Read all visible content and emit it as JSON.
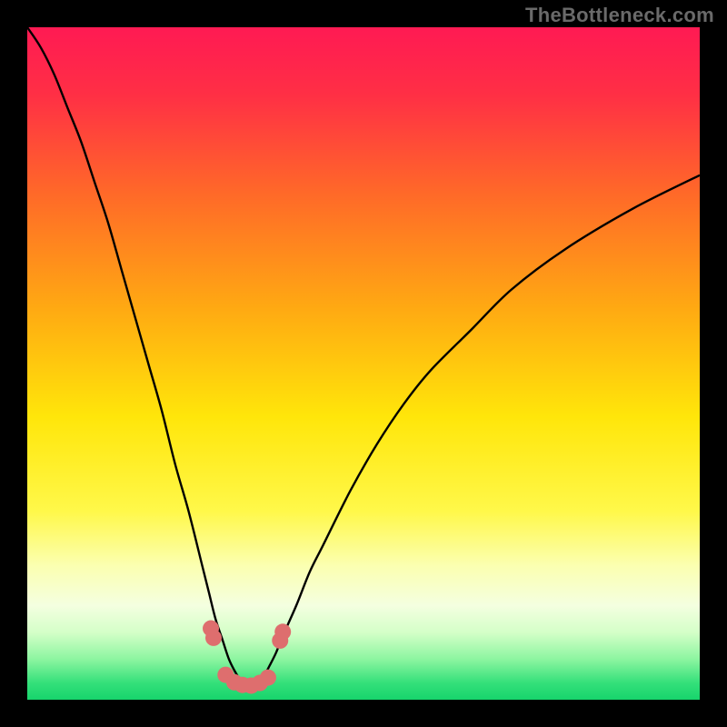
{
  "watermark": "TheBottleneck.com",
  "gradient_stops": [
    {
      "offset": 0.0,
      "color": "#ff1a53"
    },
    {
      "offset": 0.1,
      "color": "#ff2f45"
    },
    {
      "offset": 0.25,
      "color": "#ff6a28"
    },
    {
      "offset": 0.42,
      "color": "#ffaa12"
    },
    {
      "offset": 0.58,
      "color": "#ffe60a"
    },
    {
      "offset": 0.72,
      "color": "#fff84a"
    },
    {
      "offset": 0.8,
      "color": "#fbffb0"
    },
    {
      "offset": 0.86,
      "color": "#f4ffe0"
    },
    {
      "offset": 0.9,
      "color": "#d4ffc8"
    },
    {
      "offset": 0.94,
      "color": "#8cf5a0"
    },
    {
      "offset": 0.975,
      "color": "#34e07a"
    },
    {
      "offset": 1.0,
      "color": "#17d46c"
    }
  ],
  "chart_data": {
    "type": "line",
    "title": "",
    "xlabel": "",
    "ylabel": "",
    "x_range": [
      0,
      100
    ],
    "y_range": [
      0,
      100
    ],
    "curve_description": "bottleneck-percentage curve with sharp V-shaped minimum near x≈33; left branch from top-left corner, right branch rises toward upper-right",
    "x": [
      0,
      2,
      4,
      6,
      8,
      10,
      12,
      14,
      16,
      18,
      20,
      22,
      24,
      26,
      27,
      28,
      29,
      30,
      31,
      32,
      33,
      34,
      35,
      36,
      37,
      38,
      40,
      42,
      44,
      48,
      52,
      56,
      60,
      66,
      72,
      80,
      90,
      100
    ],
    "y": [
      100,
      97,
      93,
      88,
      83,
      77,
      71,
      64,
      57,
      50,
      43,
      35,
      28,
      20,
      16,
      12,
      9,
      6,
      4,
      2.5,
      2,
      2.3,
      3.2,
      5,
      7,
      9.5,
      14,
      19,
      23,
      31,
      38,
      44,
      49,
      55,
      61,
      67,
      73,
      78
    ],
    "markers": {
      "x": [
        27.3,
        27.7,
        29.5,
        30.8,
        32.0,
        33.3,
        34.6,
        35.8,
        37.6,
        38.0
      ],
      "y": [
        10.6,
        9.2,
        3.7,
        2.6,
        2.2,
        2.1,
        2.5,
        3.3,
        8.8,
        10.1
      ],
      "color": "#de6e6e",
      "radius": 9
    }
  }
}
